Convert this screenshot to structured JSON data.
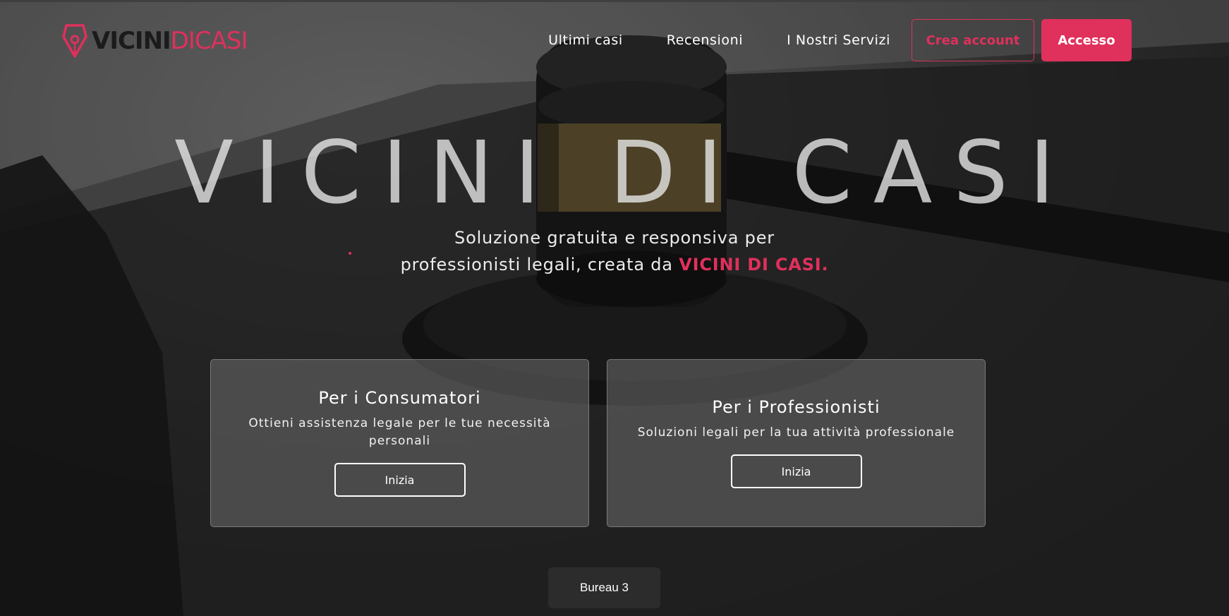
{
  "brand": {
    "logo_part1": "VICINI",
    "logo_part2": "DICASI",
    "accent_color": "#e0305c"
  },
  "nav": {
    "links": [
      "Ultimi casi",
      "Recensioni",
      "I Nostri Servizi"
    ],
    "create_account_label": "Crea account",
    "login_label": "Accesso"
  },
  "hero": {
    "title": "VICINI DI CASI",
    "subtitle_line1": "Soluzione gratuita e responsiva per",
    "subtitle_line2": "professionisti legali, creata da",
    "subtitle_brand": "VICINI DI CASI."
  },
  "cards": [
    {
      "title": "Per i Consumatori",
      "description": "Ottieni assistenza legale per le tue necessità personali",
      "button_label": "Inizia"
    },
    {
      "title": "Per i Professionisti",
      "description": "Soluzioni legali per la tua attività professionale",
      "button_label": "Inizia"
    }
  ],
  "footer_button": "Bureau 3",
  "icons": {
    "logo": "pen-nib-icon"
  }
}
